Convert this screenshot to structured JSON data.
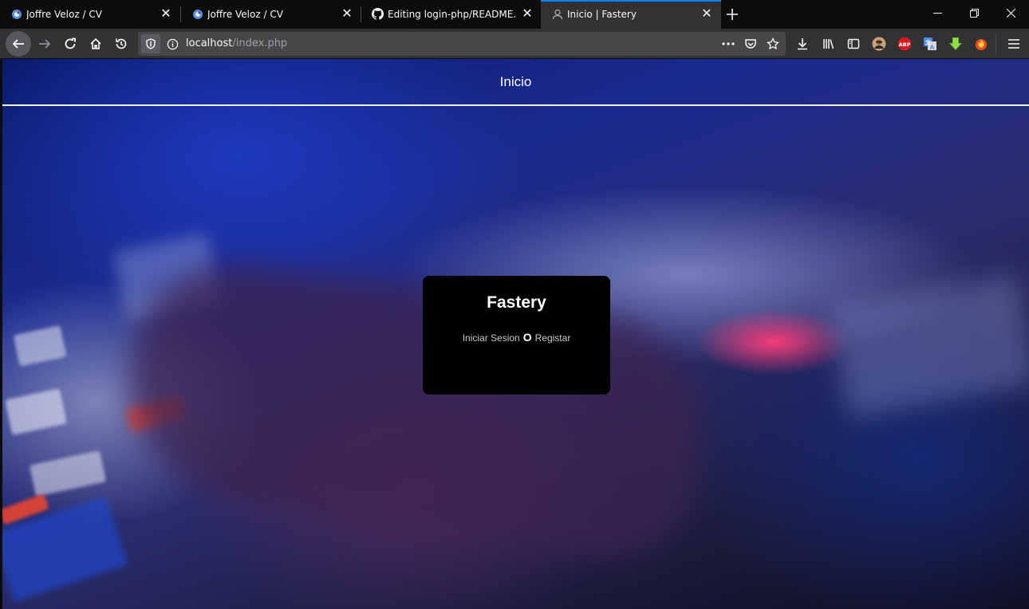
{
  "browser": {
    "tabs": [
      {
        "title": "Joffre Veloz / CV",
        "icon": "favicon-cv-icon",
        "selected": false
      },
      {
        "title": "Joffre Veloz / CV",
        "icon": "favicon-cv-icon",
        "selected": false
      },
      {
        "title": "Editing login-php/README.md",
        "icon": "github-icon",
        "selected": false
      },
      {
        "title": "Inicio | Fastery",
        "icon": "person-icon",
        "selected": true
      }
    ],
    "url": {
      "host": "localhost",
      "path": "/index.php"
    },
    "accent_color": "#0a84ff"
  },
  "page": {
    "header_title": "Inicio",
    "card": {
      "title": "Fastery",
      "login_label": "Iniciar Sesion",
      "or_label": "O",
      "register_label": "Registar"
    }
  }
}
